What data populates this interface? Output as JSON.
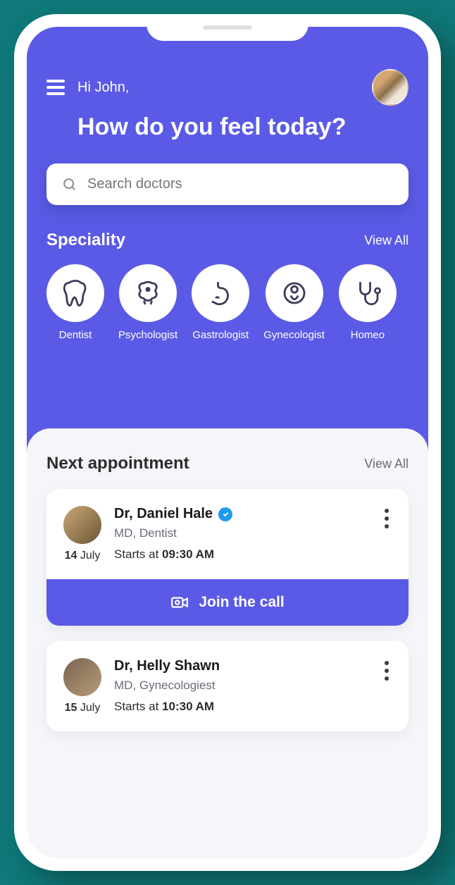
{
  "header": {
    "greeting": "Hi John,",
    "headline": "How do you feel today?"
  },
  "search": {
    "placeholder": "Search doctors"
  },
  "speciality": {
    "title": "Speciality",
    "view_all": "View All",
    "items": [
      {
        "label": "Dentist",
        "icon": "tooth"
      },
      {
        "label": "Psychologist",
        "icon": "brain"
      },
      {
        "label": "Gastrologist",
        "icon": "stomach"
      },
      {
        "label": "Gynecologist",
        "icon": "baby"
      },
      {
        "label": "Homeo",
        "icon": "stethoscope"
      }
    ]
  },
  "appointments": {
    "title": "Next appointment",
    "view_all": "View All",
    "items": [
      {
        "name": "Dr, Daniel Hale",
        "verified": true,
        "credentials": "MD, Dentist",
        "day": "14",
        "month": "July",
        "starts_label": "Starts at",
        "time": "09:30 AM",
        "join_label": "Join the call",
        "show_join": true
      },
      {
        "name": "Dr, Helly Shawn",
        "verified": false,
        "credentials": "MD, Gynecologiest",
        "day": "15",
        "month": "July",
        "starts_label": "Starts at",
        "time": "10:30 AM",
        "show_join": false
      }
    ]
  },
  "colors": {
    "primary": "#5a5ae6",
    "verified": "#1e9bf0"
  }
}
